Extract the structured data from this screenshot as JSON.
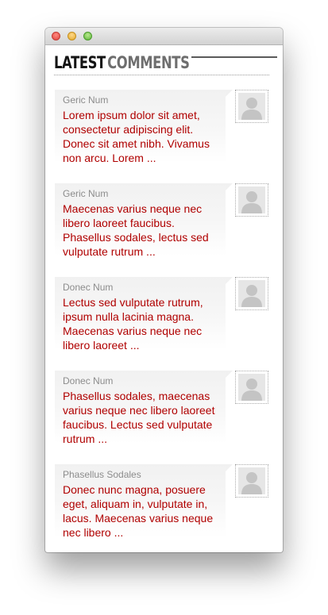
{
  "widget": {
    "title_latest": "LATEST",
    "title_comments": "COMMENTS"
  },
  "comments": [
    {
      "author": "Geric Num",
      "text": "Lorem ipsum dolor sit amet, consectetur adipiscing elit. Donec sit amet nibh. Vivamus non arcu. Lorem ..."
    },
    {
      "author": "Geric Num",
      "text": "Maecenas varius neque nec libero laoreet faucibus. Phasellus sodales, lectus sed vulputate rutrum ..."
    },
    {
      "author": "Donec Num",
      "text": "Lectus sed vulputate rutrum, ipsum nulla lacinia magna. Maecenas varius neque nec libero laoreet ..."
    },
    {
      "author": "Donec Num",
      "text": "Phasellus sodales, maecenas varius neque nec libero laoreet faucibus. Lectus sed vulputate rutrum ..."
    },
    {
      "author": "Phasellus Sodales",
      "text": "Donec nunc magna, posuere eget, aliquam in, vulputate in, lacus. Maecenas varius neque nec libero ..."
    }
  ],
  "colors": {
    "comment_text": "#b00000",
    "author_text": "#8c8c8c",
    "title_dark": "#141414",
    "title_light": "#6e6e6e"
  },
  "icons": {
    "avatar": "user-silhouette-icon"
  }
}
